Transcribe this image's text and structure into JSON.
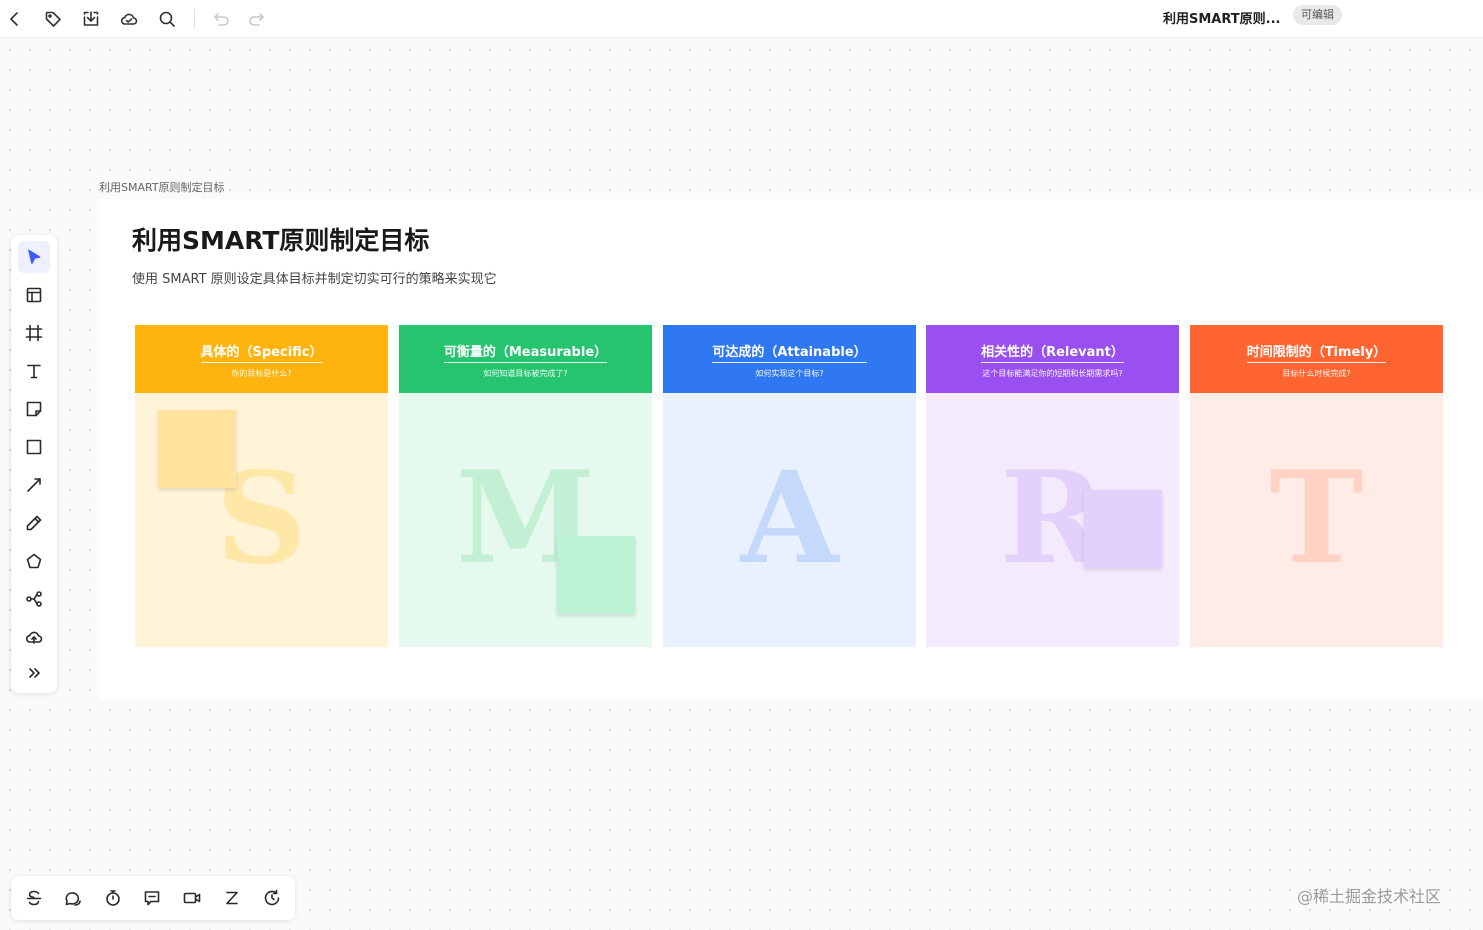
{
  "topbar": {
    "doc_title": "利用SMART原则...",
    "edit_badge": "可编辑",
    "icons": [
      "back-icon",
      "tag-icon",
      "download-icon",
      "cloud-icon",
      "search-icon",
      "undo-icon",
      "redo-icon"
    ]
  },
  "left_toolbar": {
    "tools": [
      "select-icon",
      "template-icon",
      "frame-icon",
      "text-icon",
      "sticky-note-icon",
      "rectangle-icon",
      "line-icon",
      "pen-icon",
      "shape-icon",
      "mindmap-icon",
      "upload-icon",
      "more-icon"
    ],
    "active_tool": "select-icon"
  },
  "bottom_toolbar": {
    "tools": [
      "strike-icon",
      "comment-icon",
      "timer-icon",
      "chat-icon",
      "video-icon",
      "sleep-icon",
      "history-icon"
    ]
  },
  "frame": {
    "label": "利用SMART原则制定目标",
    "title": "利用SMART原则制定目标",
    "subtitle": "使用 SMART 原则设定具体目标并制定切实可行的策略来实现它"
  },
  "columns": [
    {
      "title": "具体的（Specific）",
      "question": "你的目标是什么?",
      "letter": "S",
      "head_color": "#ffb30f",
      "body_color": "#fff3d8",
      "letter_color": "#ffe7a8",
      "sticky_color": "#ffe39f"
    },
    {
      "title": "可衡量的（Measurable）",
      "question": "如何知道目标被完成了?",
      "letter": "M",
      "head_color": "#27c470",
      "body_color": "#e6f9ee",
      "letter_color": "#c2f0d4",
      "sticky_color": "#bdf1d3"
    },
    {
      "title": "可达成的（Attainable）",
      "question": "如何实现这个目标?",
      "letter": "A",
      "head_color": "#2f78f2",
      "body_color": "#e9f1fe",
      "letter_color": "#c5d9fc",
      "sticky_color": null
    },
    {
      "title": "相关性的（Relevant）",
      "question": "这个目标能满足你的短期和长期需求吗?",
      "letter": "R",
      "head_color": "#9a4ff0",
      "body_color": "#f3ebfd",
      "letter_color": "#e3d0fb",
      "sticky_color": "#e4d1fb"
    },
    {
      "title": "时间限制的（Timely）",
      "question": "目标什么时候完成?",
      "letter": "T",
      "head_color": "#ff6431",
      "body_color": "#ffece6",
      "letter_color": "#ffd2c4",
      "sticky_color": null
    }
  ],
  "watermark": "@稀土掘金技术社区"
}
